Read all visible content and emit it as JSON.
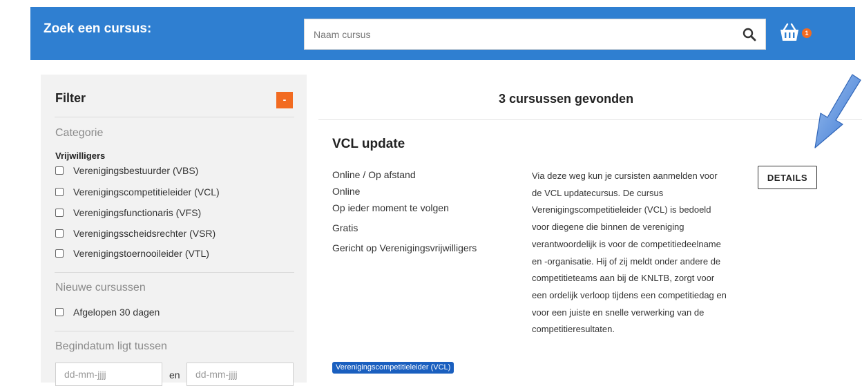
{
  "header": {
    "title": "Zoek een cursus:",
    "search_placeholder": "Naam cursus",
    "basket_count": "1",
    "accent_color": "#2f7fd1"
  },
  "sidebar": {
    "filter_title": "Filter",
    "toggle_label": "-",
    "categorie": {
      "title": "Categorie",
      "group": "Vrijwilligers",
      "items": [
        "Verenigingsbestuurder (VBS)",
        "Verenigingscompetitieleider (VCL)",
        "Verenigingsfunctionaris (VFS)",
        "Verenigingsscheidsrechter (VSR)",
        "Verenigingstoernooileider (VTL)"
      ]
    },
    "nieuwe": {
      "title": "Nieuwe cursussen",
      "items": [
        "Afgelopen 30 dagen"
      ]
    },
    "begindatum": {
      "title": "Begindatum ligt tussen",
      "from_placeholder": "dd-mm-jjjj",
      "separator": "en",
      "to_placeholder": "dd-mm-jjjj"
    }
  },
  "results": {
    "count_text": "3 cursussen gevonden"
  },
  "course": {
    "title": "VCL update",
    "meta": [
      "Online / Op afstand",
      "Online",
      "Op ieder moment te volgen",
      "Gratis",
      "Gericht op Verenigingsvrijwilligers"
    ],
    "description": "Via deze weg kun je cursisten aanmelden voor de VCL updatecursus. De cursus Verenigingscompetitieleider (VCL) is bedoeld voor diegene die binnen de vereniging verantwoordelijk is voor de competitiedeelname en -organisatie. Hij of zij meldt onder andere de competitieteams aan bij de KNLTB, zorgt voor een ordelijk verloop tijdens een competitiedag en voor een juiste en snelle verwerking van de competitieresultaten.",
    "details_label": "DETAILS",
    "tag": "Verenigingscompetitieleider (VCL)"
  }
}
